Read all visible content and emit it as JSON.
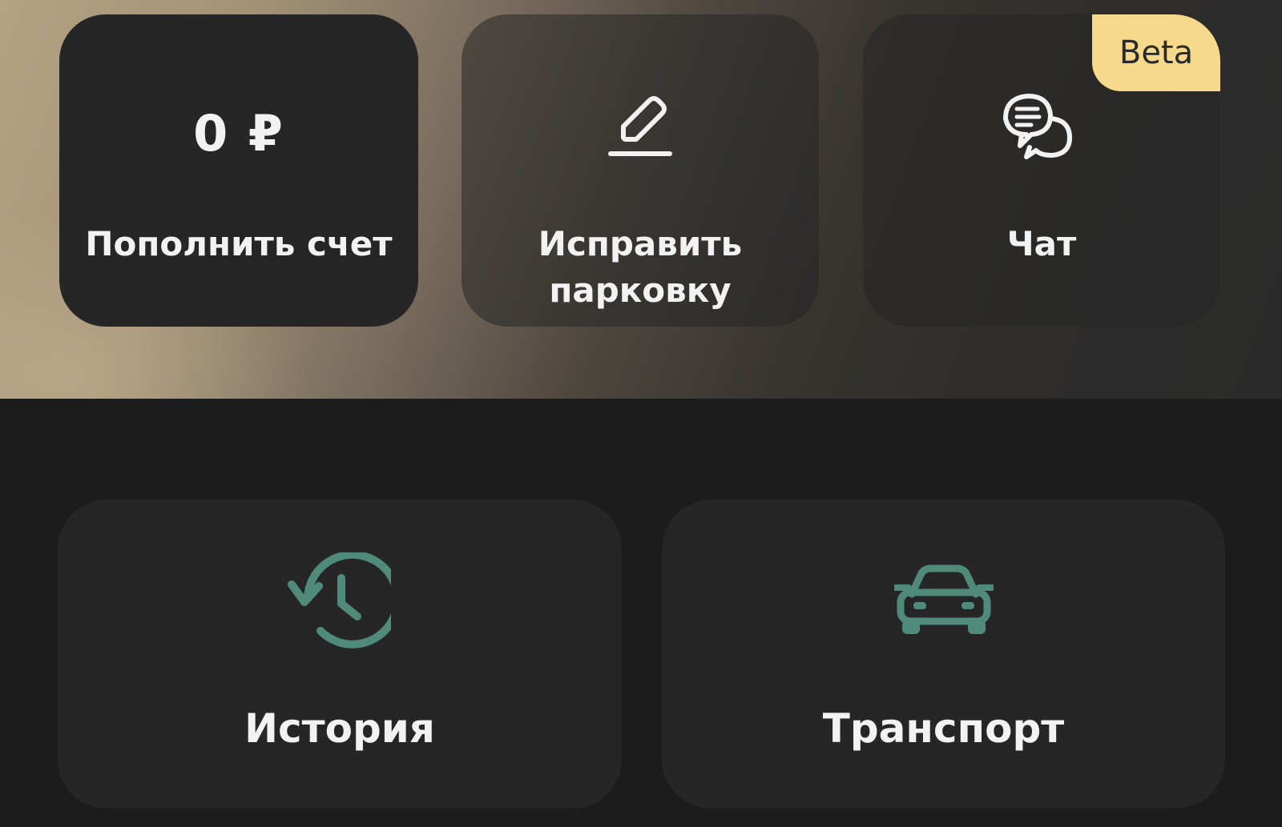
{
  "colors": {
    "tile_background": "#262626",
    "accent_teal": "#4f8a7a",
    "beta_badge": "#f6d98a",
    "text_primary": "#f2f2f2"
  },
  "top_row": {
    "balance": {
      "value": "0 ₽",
      "label": "Пополнить счет"
    },
    "fix_parking": {
      "icon": "edit-pencil-icon",
      "label_line1": "Исправить",
      "label_line2": "парковку"
    },
    "chat": {
      "icon": "chat-bubbles-icon",
      "label": "Чат",
      "badge": "Beta"
    }
  },
  "bottom_row": {
    "history": {
      "icon": "history-clock-icon",
      "label": "История"
    },
    "transport": {
      "icon": "car-icon",
      "label": "Транспорт"
    }
  }
}
